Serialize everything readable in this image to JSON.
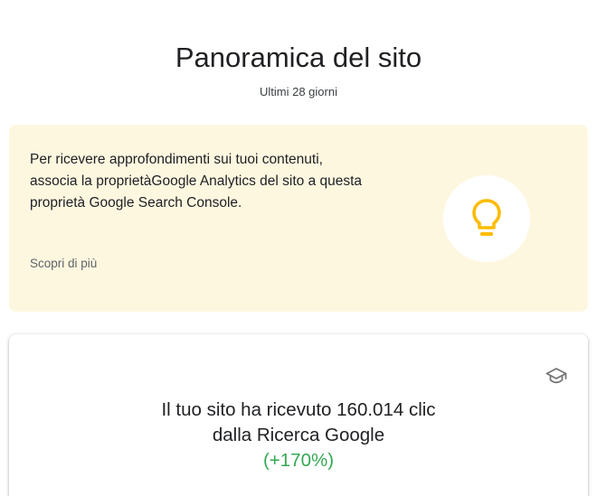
{
  "header": {
    "title": "Panoramica del sito",
    "subtitle": "Ultimi 28 giorni"
  },
  "insight_card": {
    "text": "Per ricevere approfondimenti sui tuoi contenuti, associa la proprietàGoogle Analytics del sito a questa proprietà Google Search Console.",
    "link_label": "Scopri di più",
    "icon": "lightbulb-icon",
    "background_color": "#fef7e0",
    "icon_color": "#fbbc04"
  },
  "summary_card": {
    "line1": "Il tuo sito ha ricevuto 160.014 clic",
    "line2": "dalla Ricerca Google",
    "change": "(+170%)",
    "change_color": "#34a853",
    "icon": "graduation-cap-icon"
  }
}
